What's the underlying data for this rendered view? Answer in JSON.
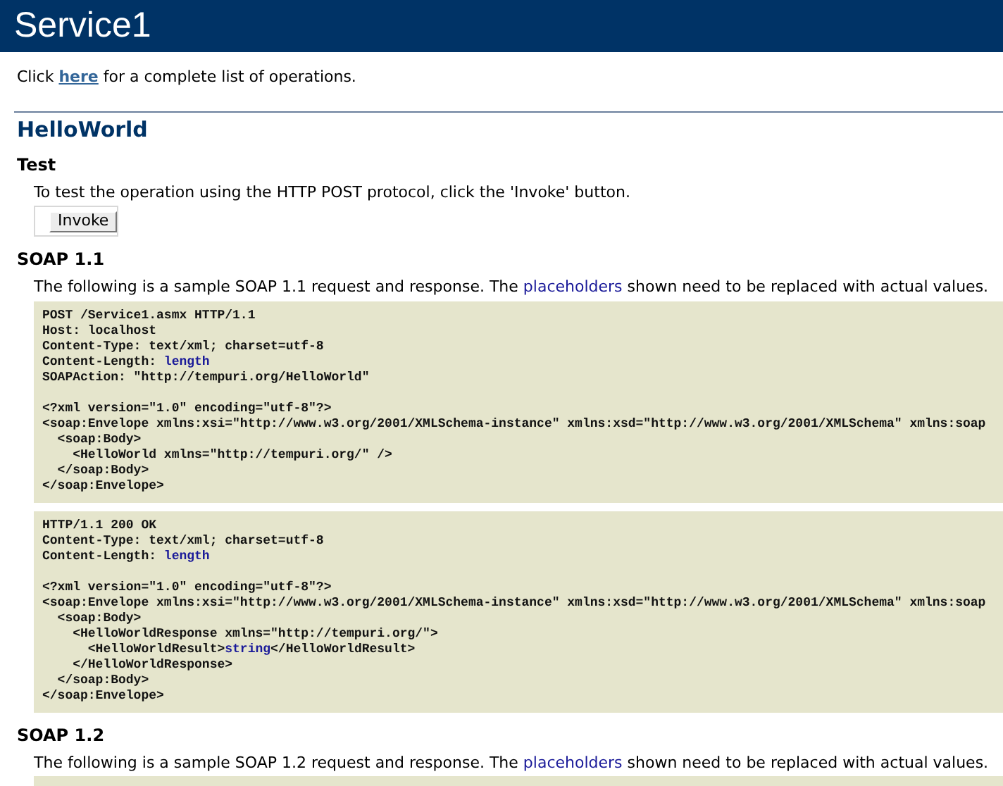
{
  "header": {
    "title": "Service1"
  },
  "intro": {
    "before": "Click ",
    "link": "here",
    "after": " for a complete list of operations."
  },
  "operation": {
    "title": "HelloWorld",
    "test": {
      "heading": "Test",
      "text": "To test the operation using the HTTP POST protocol, click the 'Invoke' button.",
      "button": "Invoke"
    },
    "sections": [
      {
        "heading": "SOAP 1.1",
        "text_before": "The following is a sample SOAP 1.1 request and response. The ",
        "link": "placeholders",
        "text_after": " shown need to be replaced with actual values.",
        "code_blocks": [
          {
            "cut_off": false,
            "groups": [
              [
                [
                  {
                    "kind": "text",
                    "text": "POST /Service1.asmx HTTP/1.1"
                  }
                ],
                [
                  {
                    "kind": "text",
                    "text": "Host: localhost"
                  }
                ],
                [
                  {
                    "kind": "text",
                    "text": "Content-Type: text/xml; charset=utf-8"
                  }
                ],
                [
                  {
                    "kind": "text",
                    "text": "Content-Length: "
                  },
                  {
                    "kind": "placeholder",
                    "text": "length"
                  }
                ],
                [
                  {
                    "kind": "text",
                    "text": "SOAPAction: \"http://tempuri.org/HelloWorld\""
                  }
                ]
              ],
              [
                [
                  {
                    "kind": "text",
                    "text": "<?xml version=\"1.0\" encoding=\"utf-8\"?>"
                  }
                ],
                [
                  {
                    "kind": "text",
                    "text": "<soap:Envelope xmlns:xsi=\"http://www.w3.org/2001/XMLSchema-instance\" xmlns:xsd=\"http://www.w3.org/2001/XMLSchema\" xmlns:soap"
                  }
                ],
                [
                  {
                    "kind": "text",
                    "text": "  <soap:Body>"
                  }
                ],
                [
                  {
                    "kind": "text",
                    "text": "    <HelloWorld xmlns=\"http://tempuri.org/\" />"
                  }
                ],
                [
                  {
                    "kind": "text",
                    "text": "  </soap:Body>"
                  }
                ],
                [
                  {
                    "kind": "text",
                    "text": "</soap:Envelope>"
                  }
                ]
              ]
            ]
          },
          {
            "cut_off": false,
            "groups": [
              [
                [
                  {
                    "kind": "text",
                    "text": "HTTP/1.1 200 OK"
                  }
                ],
                [
                  {
                    "kind": "text",
                    "text": "Content-Type: text/xml; charset=utf-8"
                  }
                ],
                [
                  {
                    "kind": "text",
                    "text": "Content-Length: "
                  },
                  {
                    "kind": "placeholder",
                    "text": "length"
                  }
                ]
              ],
              [
                [
                  {
                    "kind": "text",
                    "text": "<?xml version=\"1.0\" encoding=\"utf-8\"?>"
                  }
                ],
                [
                  {
                    "kind": "text",
                    "text": "<soap:Envelope xmlns:xsi=\"http://www.w3.org/2001/XMLSchema-instance\" xmlns:xsd=\"http://www.w3.org/2001/XMLSchema\" xmlns:soap"
                  }
                ],
                [
                  {
                    "kind": "text",
                    "text": "  <soap:Body>"
                  }
                ],
                [
                  {
                    "kind": "text",
                    "text": "    <HelloWorldResponse xmlns=\"http://tempuri.org/\">"
                  }
                ],
                [
                  {
                    "kind": "text",
                    "text": "      <HelloWorldResult>"
                  },
                  {
                    "kind": "placeholder",
                    "text": "string"
                  },
                  {
                    "kind": "text",
                    "text": "</HelloWorldResult>"
                  }
                ],
                [
                  {
                    "kind": "text",
                    "text": "    </HelloWorldResponse>"
                  }
                ],
                [
                  {
                    "kind": "text",
                    "text": "  </soap:Body>"
                  }
                ],
                [
                  {
                    "kind": "text",
                    "text": "</soap:Envelope>"
                  }
                ]
              ]
            ]
          }
        ]
      },
      {
        "heading": "SOAP 1.2",
        "text_before": "The following is a sample SOAP 1.2 request and response. The ",
        "link": "placeholders",
        "text_after": " shown need to be replaced with actual values.",
        "code_blocks": [
          {
            "cut_off": true
          }
        ]
      }
    ]
  }
}
